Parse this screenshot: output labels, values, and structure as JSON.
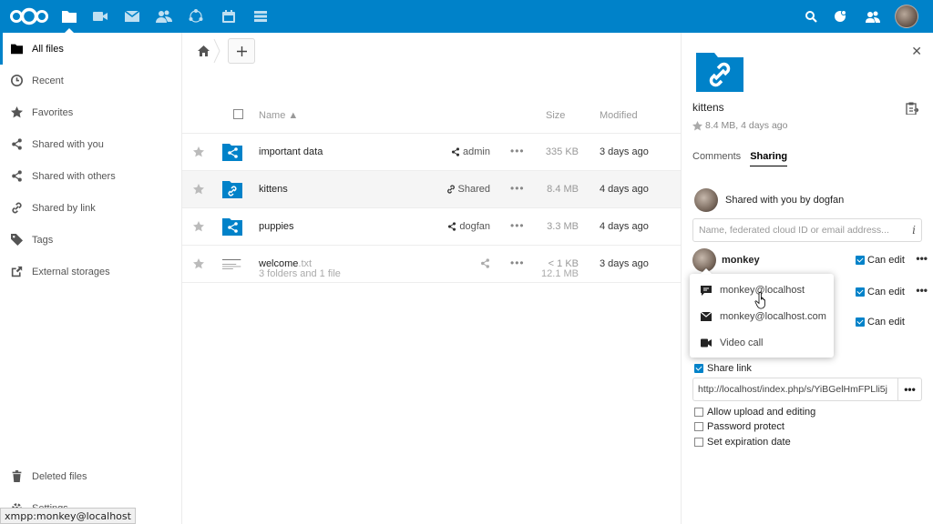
{
  "header": {
    "apps": [
      "files",
      "video",
      "mail",
      "contacts",
      "circles",
      "calendar",
      "deck"
    ],
    "right_icons": [
      "search-icon",
      "notifications-icon",
      "contacts-menu-icon"
    ],
    "brand_color": "#0082c9"
  },
  "nav": {
    "items": [
      {
        "label": "All files",
        "icon": "folder-icon"
      },
      {
        "label": "Recent",
        "icon": "clock-icon"
      },
      {
        "label": "Favorites",
        "icon": "star-icon"
      },
      {
        "label": "Shared with you",
        "icon": "share-icon"
      },
      {
        "label": "Shared with others",
        "icon": "share-icon"
      },
      {
        "label": "Shared by link",
        "icon": "link-icon"
      },
      {
        "label": "Tags",
        "icon": "tag-icon"
      },
      {
        "label": "External storages",
        "icon": "external-icon"
      }
    ],
    "deleted": "Deleted files",
    "settings": "Settings"
  },
  "status_tooltip": "xmpp:monkey@localhost",
  "files": {
    "columns": {
      "name": "Name ▲",
      "size": "Size",
      "modified": "Modified"
    },
    "rows": [
      {
        "name": "important data",
        "ext": "",
        "share": "admin",
        "size": "335 KB",
        "modified": "3 days ago"
      },
      {
        "name": "kittens",
        "ext": "",
        "share": "Shared",
        "size": "8.4 MB",
        "modified": "4 days ago"
      },
      {
        "name": "puppies",
        "ext": "",
        "share": "dogfan",
        "size": "3.3 MB",
        "modified": "4 days ago"
      },
      {
        "name": "welcome",
        "ext": ".txt",
        "share": "",
        "size": "< 1 KB",
        "modified": "3 days ago"
      }
    ],
    "summary": {
      "count": "3 folders and 1 file",
      "size": "12.1 MB"
    }
  },
  "sidebar": {
    "title": "kittens",
    "meta": "8.4 MB, 4 days ago",
    "tabs": [
      "Comments",
      "Sharing"
    ],
    "shared_by": "Shared with you by dogfan",
    "share_placeholder": "Name, federated cloud ID or email address...",
    "recipients": [
      {
        "name": "monkey",
        "perm": "Can edit"
      },
      {
        "name": "",
        "perm": "Can edit"
      },
      {
        "name": "",
        "perm": "Can edit"
      }
    ],
    "popover": [
      "monkey@localhost",
      "monkey@localhost.com",
      "Video call"
    ],
    "share_link_label": "Share link",
    "share_link_url": "http://localhost/index.php/s/YiBGelHmFPLli5j",
    "options": [
      "Allow upload and editing",
      "Password protect",
      "Set expiration date"
    ]
  }
}
